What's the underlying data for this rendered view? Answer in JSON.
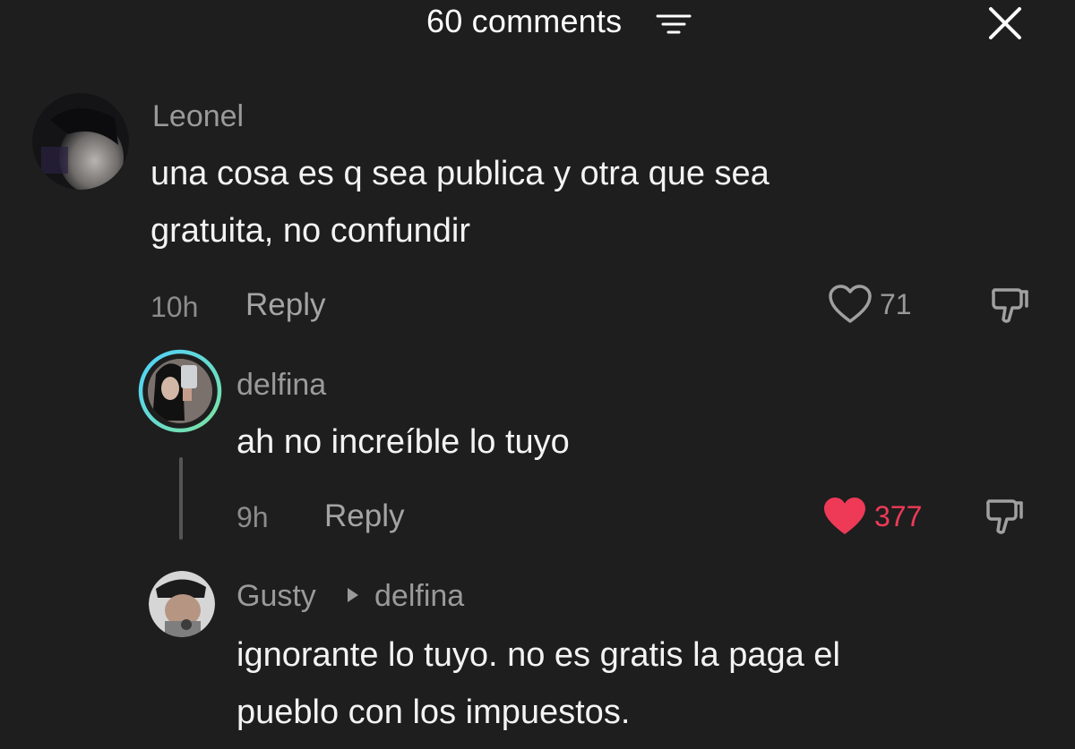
{
  "header": {
    "title": "60 comments",
    "filter_icon": "filter-lines-icon",
    "close_icon": "close-x-icon"
  },
  "comments": [
    {
      "username": "Leonel",
      "text_lines": [
        "una cosa es q sea publica y otra que sea",
        "gratuita, no confundir"
      ],
      "time": "10h",
      "reply_label": "Reply",
      "likes": "71",
      "liked": false
    },
    {
      "username": "delfina",
      "text_lines": [
        "ah no increíble lo tuyo"
      ],
      "time": "9h",
      "reply_label": "Reply",
      "likes": "377",
      "liked": true,
      "avatar_ring": true
    },
    {
      "username": "Gusty",
      "reply_to": "delfina",
      "text_lines": [
        "ignorante lo tuyo. no es gratis la paga el",
        "pueblo con los impuestos."
      ]
    }
  ],
  "colors": {
    "background": "#1e1e1e",
    "liked_heart": "#ee3a57",
    "muted_text": "#9a9a9a",
    "primary_text": "#f3f3f3",
    "story_ring_start": "#4fd1ff",
    "story_ring_end": "#7be3a0"
  }
}
